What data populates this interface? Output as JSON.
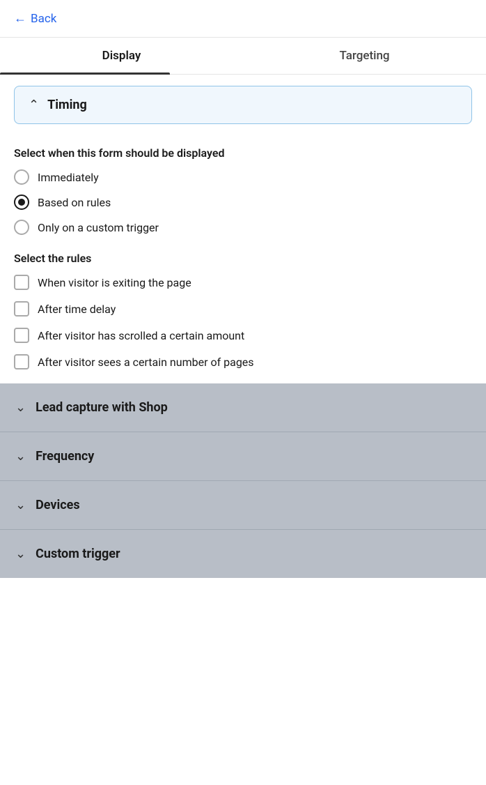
{
  "header": {
    "back_label": "Back"
  },
  "tabs": [
    {
      "id": "display",
      "label": "Display",
      "active": true
    },
    {
      "id": "targeting",
      "label": "Targeting",
      "active": false
    }
  ],
  "timing": {
    "title": "Timing",
    "select_display_label": "Select when this form should be displayed",
    "radio_options": [
      {
        "id": "immediately",
        "label": "Immediately",
        "selected": false
      },
      {
        "id": "based_on_rules",
        "label": "Based on rules",
        "selected": true
      },
      {
        "id": "custom_trigger",
        "label": "Only on a custom trigger",
        "selected": false
      }
    ],
    "select_rules_label": "Select the rules",
    "checkbox_options": [
      {
        "id": "exit_page",
        "label": "When visitor is exiting the page",
        "checked": false
      },
      {
        "id": "time_delay",
        "label": "After time delay",
        "checked": false
      },
      {
        "id": "scrolled",
        "label": "After visitor has scrolled a certain amount",
        "checked": false
      },
      {
        "id": "pages_seen",
        "label": "After visitor sees a certain number of pages",
        "checked": false
      }
    ]
  },
  "collapsed_sections": [
    {
      "id": "lead_capture",
      "title": "Lead capture with Shop"
    },
    {
      "id": "frequency",
      "title": "Frequency"
    },
    {
      "id": "devices",
      "title": "Devices"
    },
    {
      "id": "custom_trigger",
      "title": "Custom trigger"
    }
  ],
  "icons": {
    "back_arrow": "←",
    "chevron_up": "∧",
    "chevron_down": "∨"
  }
}
